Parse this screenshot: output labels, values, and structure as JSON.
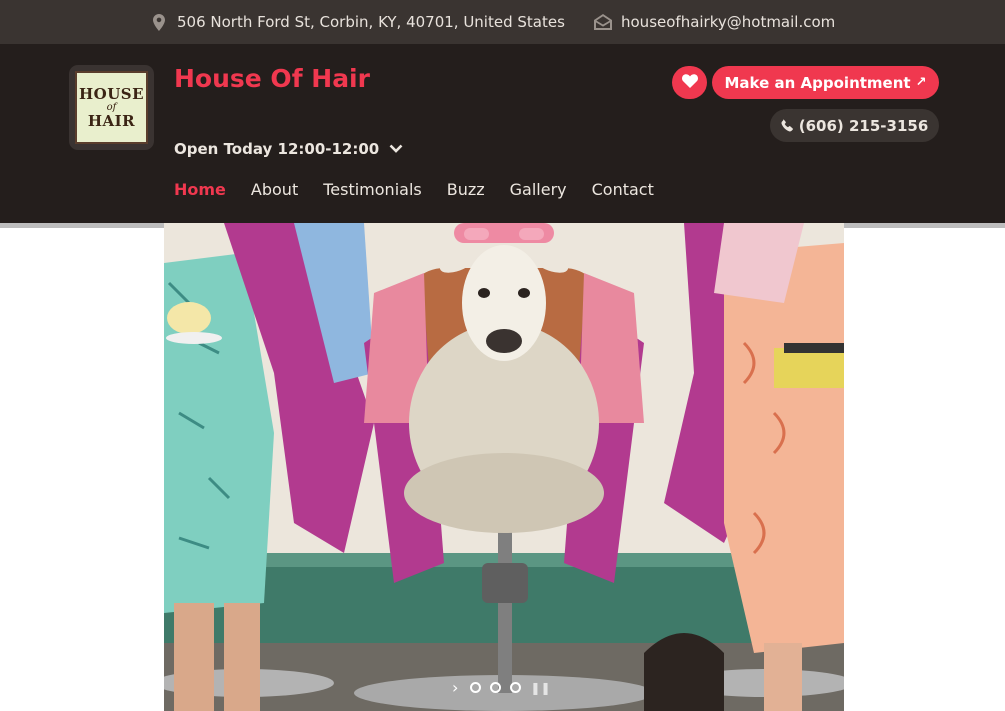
{
  "topbar": {
    "address": "506 North Ford St, Corbin, KY, 40701, United States",
    "email": "houseofhairky@hotmail.com"
  },
  "logo": {
    "line1": "HOUSE",
    "line2": "of",
    "line3": "HAIR"
  },
  "site": {
    "title": "House Of Hair",
    "hours": "Open Today 12:00-12:00"
  },
  "nav": {
    "items": [
      {
        "label": "Home",
        "active": true
      },
      {
        "label": "About"
      },
      {
        "label": "Testimonials"
      },
      {
        "label": "Buzz"
      },
      {
        "label": "Gallery"
      },
      {
        "label": "Contact"
      }
    ]
  },
  "actions": {
    "appointment_label": "Make an Appointment",
    "phone": "(606) 215-3156"
  },
  "colors": {
    "accent": "#f0384f",
    "header_bg": "#241e1c",
    "topbar_bg": "#3a3431"
  },
  "icons": {
    "address": "map-pin-icon",
    "email": "envelope-icon",
    "favorite": "heart-icon",
    "phone": "phone-icon",
    "hours_toggle": "chevron-down-icon",
    "slider_next": "chevron-right-icon"
  },
  "slider": {
    "slide_count": 3
  }
}
